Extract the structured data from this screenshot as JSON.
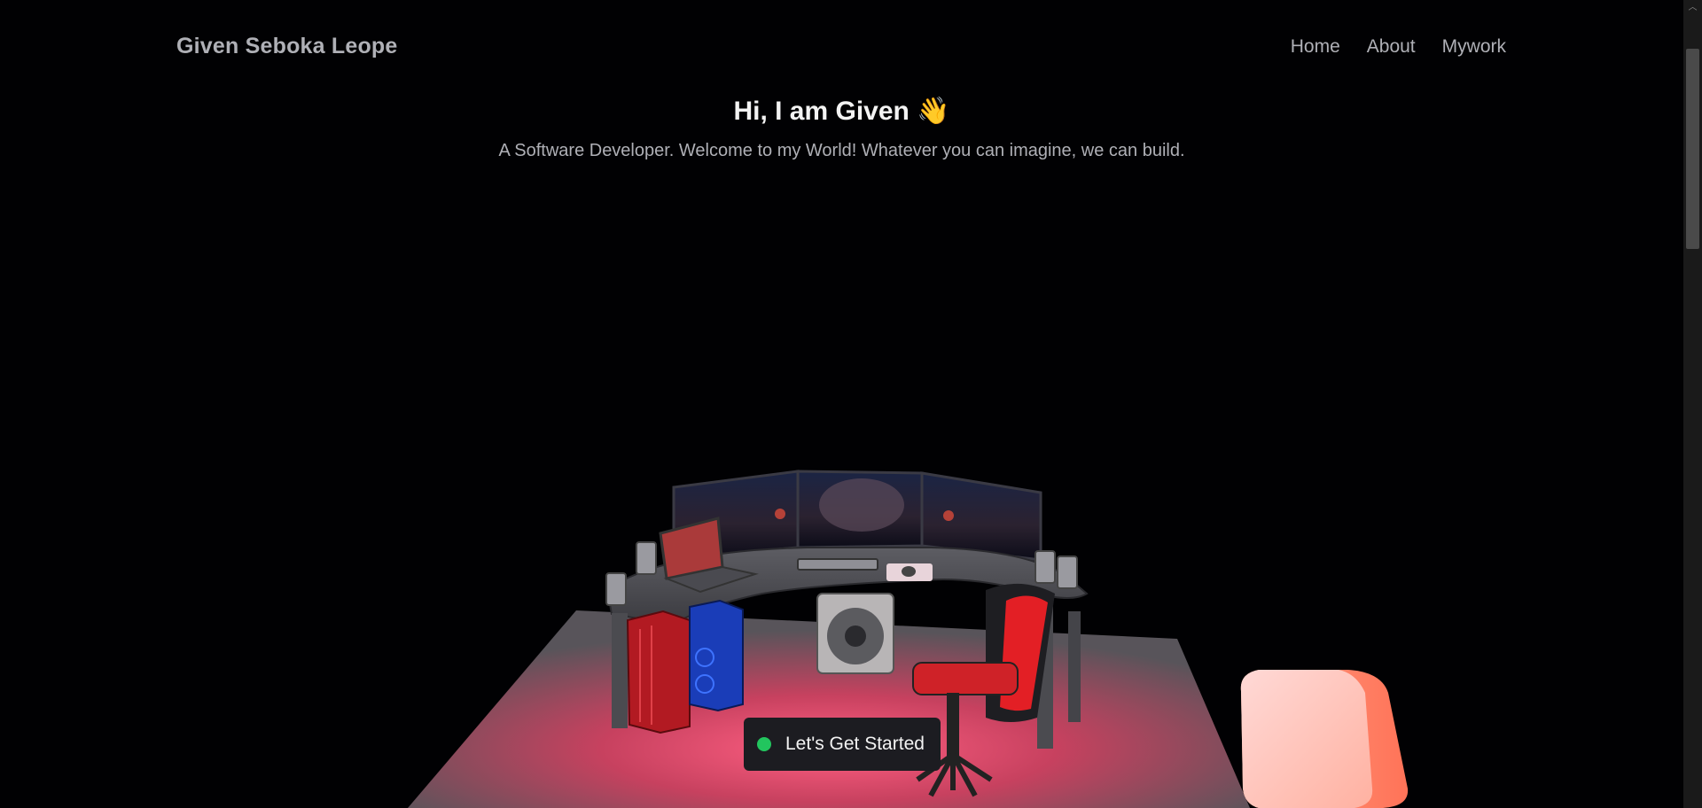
{
  "brand": "Given Seboka Leope",
  "nav": {
    "items": [
      "Home",
      "About",
      "Mywork"
    ]
  },
  "hero": {
    "title": "Hi, I am Given 👋",
    "subtitle": "A Software Developer. Welcome to my World! Whatever you can imagine, we can build."
  },
  "cta": {
    "label": "Let's Get Started",
    "dot_color": "#22c55e"
  },
  "colors": {
    "background": "#010103",
    "text_muted": "#afb0b6",
    "text_primary": "#f3f3f3",
    "button_bg": "#1c1c21",
    "floor_glow": "#ff5a78"
  }
}
